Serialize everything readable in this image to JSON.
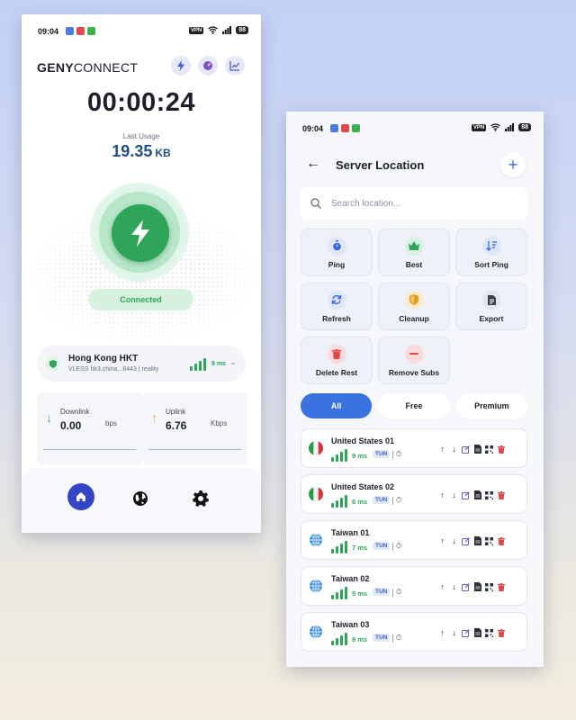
{
  "phone1": {
    "status": {
      "time": "09:04",
      "vpn": "VPN",
      "battery": "88"
    },
    "brand": {
      "bold": "GENY",
      "rest": "CONNECT"
    },
    "timer": "00:00:24",
    "last_usage_label": "Last Usage",
    "usage_value": "19.35",
    "usage_unit": "KB",
    "connected_label": "Connected",
    "server": {
      "name": "Hong Kong HKT",
      "detail": "VLESS  hk3.china...8443  |  reality",
      "ping": "9 ms"
    },
    "downlink": {
      "label": "Downlink",
      "value": "0.00",
      "unit": "bps"
    },
    "uplink": {
      "label": "Uplink",
      "value": "6.76",
      "unit": "Kbps"
    },
    "icons": [
      "lightning-icon",
      "speedometer-icon",
      "chart-icon",
      "power-icon",
      "shield-icon",
      "signal-icon",
      "chevron-down-icon",
      "home-icon",
      "globe-icon",
      "settings-icon"
    ],
    "colors": {
      "accent": "#2fa55a",
      "nav_active": "#3346c7",
      "usage": "#1f4f86"
    }
  },
  "phone2": {
    "status": {
      "time": "09:04",
      "vpn": "VPN",
      "battery": "88"
    },
    "title": "Server Location",
    "search_placeholder": "Search location...",
    "actions": [
      {
        "label": "Ping",
        "icon": "stopwatch-icon"
      },
      {
        "label": "Best",
        "icon": "crown-icon"
      },
      {
        "label": "Sort Ping",
        "icon": "sort-icon"
      },
      {
        "label": "Refresh",
        "icon": "refresh-icon"
      },
      {
        "label": "Cleanup",
        "icon": "shield-icon"
      },
      {
        "label": "Export",
        "icon": "document-icon"
      },
      {
        "label": "Delete Rest",
        "icon": "trash-icon"
      },
      {
        "label": "Remove Subs",
        "icon": "minus-icon"
      }
    ],
    "tabs": [
      "All",
      "Free",
      "Premium"
    ],
    "servers": [
      {
        "name": "United States 01",
        "ping": "9 ms",
        "tag": "TUN",
        "flag": "italy-flag-icon"
      },
      {
        "name": "United States 02",
        "ping": "6 ms",
        "tag": "TUN",
        "flag": "italy-flag-icon"
      },
      {
        "name": "Taiwan 01",
        "ping": "7 ms",
        "tag": "TUN",
        "flag": "globe-icon"
      },
      {
        "name": "Taiwan 02",
        "ping": "5 ms",
        "tag": "TUN",
        "flag": "globe-icon"
      },
      {
        "name": "Taiwan 03",
        "ping": "8 ms",
        "tag": "TUN",
        "flag": "globe-icon"
      }
    ],
    "colors": {
      "primary": "#3a72e0",
      "delete": "#e04848"
    }
  }
}
